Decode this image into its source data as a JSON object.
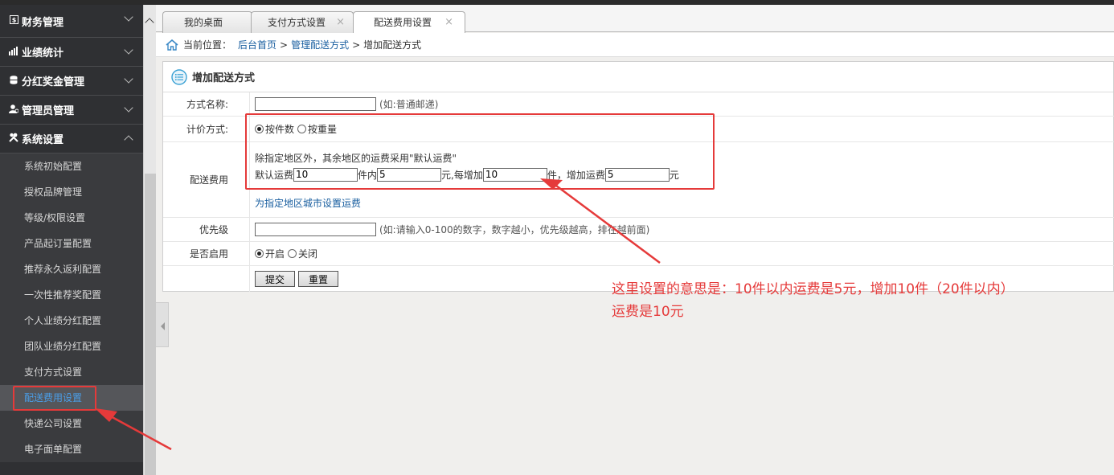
{
  "sidebar": {
    "menus": [
      {
        "label": "财务管理",
        "icon": "finance-icon"
      },
      {
        "label": "业绩统计",
        "icon": "bar-chart-icon"
      },
      {
        "label": "分红奖金管理",
        "icon": "database-icon"
      },
      {
        "label": "管理员管理",
        "icon": "user-admin-icon"
      },
      {
        "label": "系统设置",
        "icon": "tools-icon"
      }
    ],
    "sub_items": [
      {
        "label": "系统初始配置"
      },
      {
        "label": "授权品牌管理"
      },
      {
        "label": "等级/权限设置"
      },
      {
        "label": "产品起订量配置"
      },
      {
        "label": "推荐永久返利配置"
      },
      {
        "label": "一次性推荐奖配置"
      },
      {
        "label": "个人业绩分红配置"
      },
      {
        "label": "团队业绩分红配置"
      },
      {
        "label": "支付方式设置"
      },
      {
        "label": "配送费用设置"
      },
      {
        "label": "快递公司设置"
      },
      {
        "label": "电子面单配置"
      }
    ]
  },
  "tabs": [
    {
      "label": "我的桌面"
    },
    {
      "label": "支付方式设置",
      "close": "×"
    },
    {
      "label": "配送费用设置",
      "close": "×"
    }
  ],
  "breadcrumb": {
    "prefix": "当前位置：",
    "home": "后台首页",
    "sep": ">",
    "parent": "管理配送方式",
    "current": "增加配送方式"
  },
  "panel": {
    "title": "增加配送方式",
    "fields": {
      "name_label": "方式名称:",
      "name_hint": "(如:普通邮递)",
      "pricing_label": "计价方式:",
      "pricing_opt1": "按件数",
      "pricing_opt2": "按重量",
      "fee_label": "配送费用",
      "fee_desc": "除指定地区外，其余地区的运费采用\"默认运费\"",
      "fee_default_label": "默认运费",
      "fee_default_value": "10",
      "fee_within": "件内",
      "fee_within_value": "5",
      "fee_per_add": "元,每增加",
      "fee_add_count": "10",
      "fee_add_label": "件，增加运费",
      "fee_add_value": "5",
      "fee_yuan": "元",
      "region_link": "为指定地区城市设置运费",
      "priority_label": "优先级",
      "priority_hint": "(如:请输入0-100的数字，数字越小，优先级越高，排在越前面)",
      "enabled_label": "是否启用",
      "enabled_on": "开启",
      "enabled_off": "关闭"
    },
    "submit_label": "提交",
    "reset_label": "重置"
  },
  "annotation": {
    "line1": "这里设置的意思是：10件以内运费是5元，增加10件（20件以内）",
    "line2": "运费是10元"
  },
  "colors": {
    "annotation": "#e53a3a",
    "sidebar_bg": "#2f3033",
    "link": "#1a5fa0",
    "active_item": "#4a9ee8"
  }
}
